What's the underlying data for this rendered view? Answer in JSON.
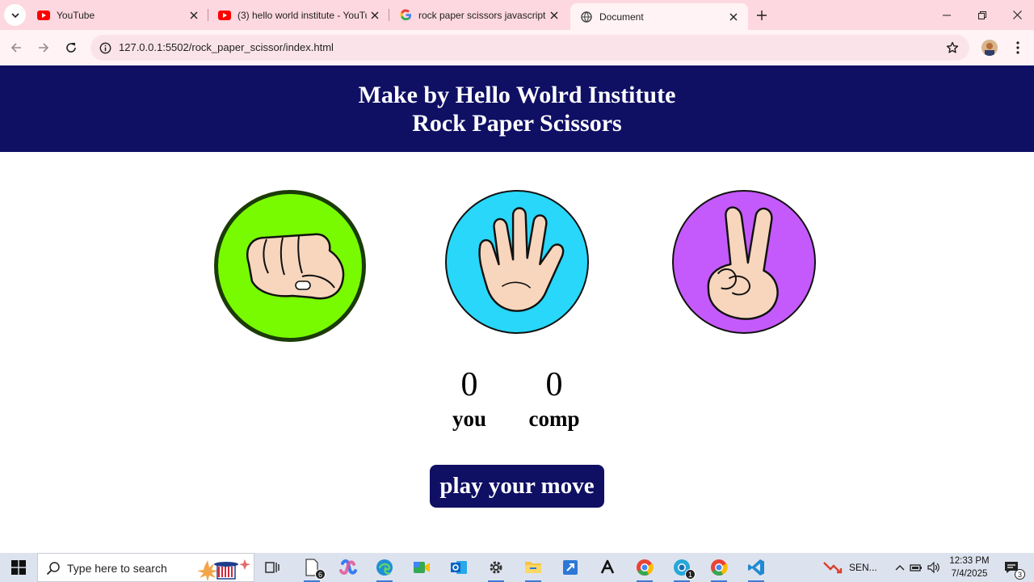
{
  "browser": {
    "tabs": [
      {
        "title": "YouTube",
        "favicon": "youtube-icon",
        "active": false
      },
      {
        "title": "(3) hello world institute - YouTu",
        "favicon": "youtube-icon",
        "active": false
      },
      {
        "title": "rock paper scissors javascript - ",
        "favicon": "google-icon",
        "active": false
      },
      {
        "title": "Document",
        "favicon": "globe-icon",
        "active": true
      }
    ],
    "url": "127.0.0.1:5502/rock_paper_scissor/index.html"
  },
  "page": {
    "header_line1": "Make by Hello Wolrd Institute",
    "header_line2": "Rock Paper Scissors",
    "choices": [
      {
        "name": "rock",
        "color": "#78fb00"
      },
      {
        "name": "paper",
        "color": "#28d7f9"
      },
      {
        "name": "scissors",
        "color": "#c55afc"
      }
    ],
    "user_score": "0",
    "user_label": "you",
    "comp_score": "0",
    "comp_label": "comp",
    "message": "play your move"
  },
  "taskbar": {
    "search_placeholder": "Type here to search",
    "file_explorer_badge": "6",
    "chrome_badge": "1",
    "weather_text": "SEN...",
    "time": "12:33 PM",
    "date": "7/4/2025",
    "notification_count": "3"
  },
  "colors": {
    "header_bg": "#0f0f64",
    "tabstrip_bg": "#fdd8e0",
    "toolbar_bg": "#fff3f5"
  }
}
